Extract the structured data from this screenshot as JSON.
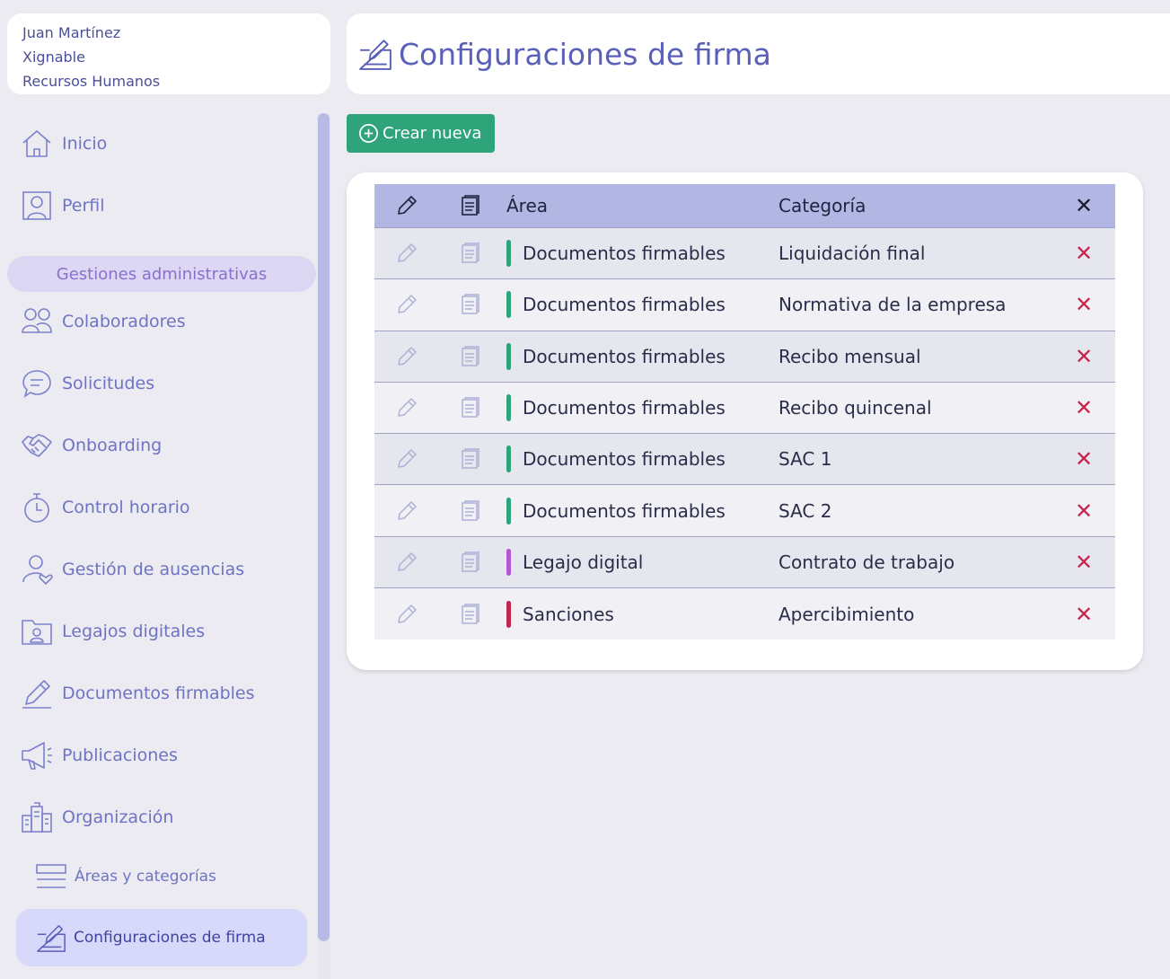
{
  "user": {
    "name": "Juan Martínez",
    "company": "Xignable",
    "department": "Recursos Humanos"
  },
  "nav": {
    "top_items": [
      {
        "label": "Inicio",
        "icon": "home-icon"
      },
      {
        "label": "Perfil",
        "icon": "profile-icon"
      }
    ],
    "section_label": "Gestiones administrativas",
    "items": [
      {
        "label": "Colaboradores",
        "icon": "users-icon"
      },
      {
        "label": "Solicitudes",
        "icon": "chat-icon"
      },
      {
        "label": "Onboarding",
        "icon": "handshake-icon"
      },
      {
        "label": "Control horario",
        "icon": "stopwatch-icon"
      },
      {
        "label": "Gestión de ausencias",
        "icon": "user-heart-icon"
      },
      {
        "label": "Legajos digitales",
        "icon": "folder-user-icon"
      },
      {
        "label": "Documentos firmables",
        "icon": "pen-icon"
      },
      {
        "label": "Publicaciones",
        "icon": "megaphone-icon"
      },
      {
        "label": "Organización",
        "icon": "building-icon"
      }
    ],
    "sub_item": {
      "label": "Áreas y categorías",
      "icon": "list-icon"
    },
    "active_item": {
      "label": "Configuraciones de firma",
      "icon": "signature-icon"
    }
  },
  "header": {
    "title": "Configuraciones de firma",
    "icon": "signature-icon"
  },
  "toolbar": {
    "create_label": "Crear nueva",
    "create_icon": "plus-circle-icon"
  },
  "table": {
    "columns": {
      "edit": "edit-icon",
      "docs": "document-icon",
      "area": "Área",
      "category": "Categoría",
      "delete": "close-icon"
    },
    "rows": [
      {
        "area": "Documentos firmables",
        "category": "Liquidación final",
        "area_color": "#2fa37a"
      },
      {
        "area": "Documentos firmables",
        "category": "Normativa de la empresa",
        "area_color": "#2fa37a"
      },
      {
        "area": "Documentos firmables",
        "category": "Recibo mensual",
        "area_color": "#2fa37a"
      },
      {
        "area": "Documentos firmables",
        "category": "Recibo quincenal",
        "area_color": "#2fa37a"
      },
      {
        "area": "Documentos firmables",
        "category": "SAC 1",
        "area_color": "#2fa37a"
      },
      {
        "area": "Documentos firmables",
        "category": "SAC 2",
        "area_color": "#2fa37a"
      },
      {
        "area": "Legajo digital",
        "category": "Contrato de trabajo",
        "area_color": "#b25ad6"
      },
      {
        "area": "Sanciones",
        "category": "Apercibimiento",
        "area_color": "#c0284f"
      }
    ]
  },
  "colors": {
    "accent": "#5a5fb8",
    "create_button": "#2fa37a",
    "delete": "#c8244e",
    "table_header": "#b1b7e2",
    "active_nav": "#d8d8fb",
    "section_pill": "#dcd7f2"
  }
}
